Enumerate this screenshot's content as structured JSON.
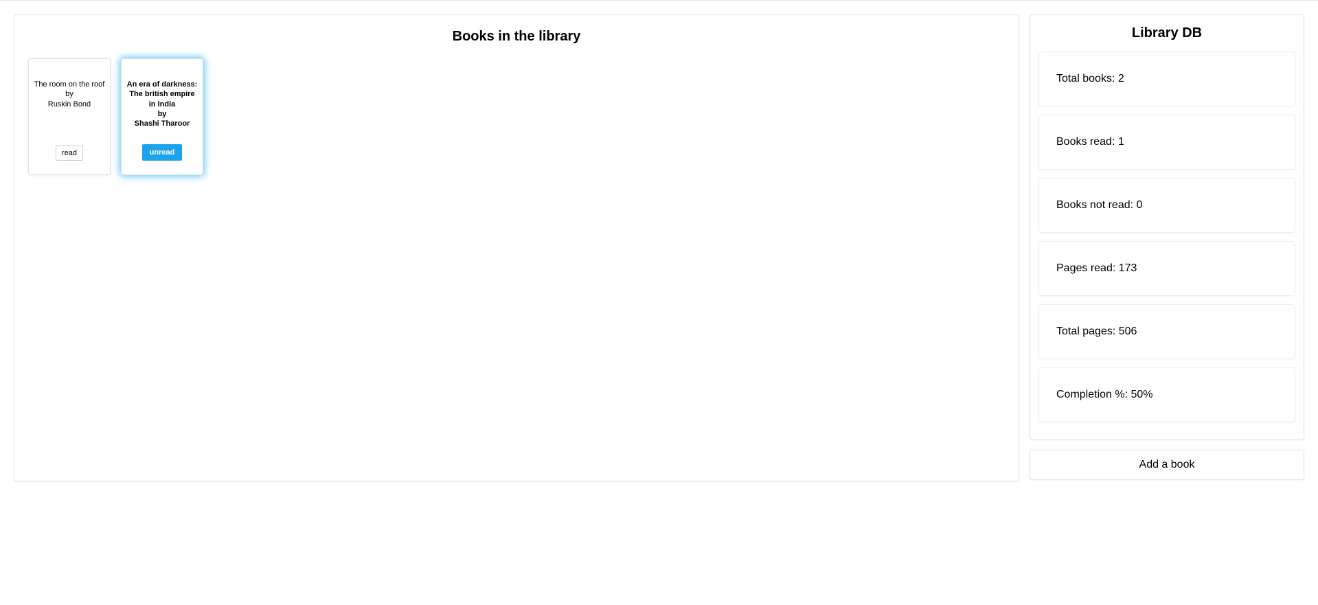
{
  "main": {
    "title": "Books in the library",
    "by_label": "by",
    "books": [
      {
        "title": "The room on the roof",
        "author": "Ruskin Bond",
        "status_label": "read",
        "active": false
      },
      {
        "title": "An era of darkness: The british empire in India",
        "author": "Shashi Tharoor",
        "status_label": "unread",
        "active": true
      }
    ]
  },
  "sidebar": {
    "title": "Library DB",
    "stats": {
      "total_books": "Total books: 2",
      "books_read": "Books read: 1",
      "books_unread": "Books not read: 0",
      "pages_read": "Pages read: 173",
      "total_pages": "Total pages: 506",
      "completion": "Completion %: 50%"
    },
    "add_label": "Add a book"
  }
}
